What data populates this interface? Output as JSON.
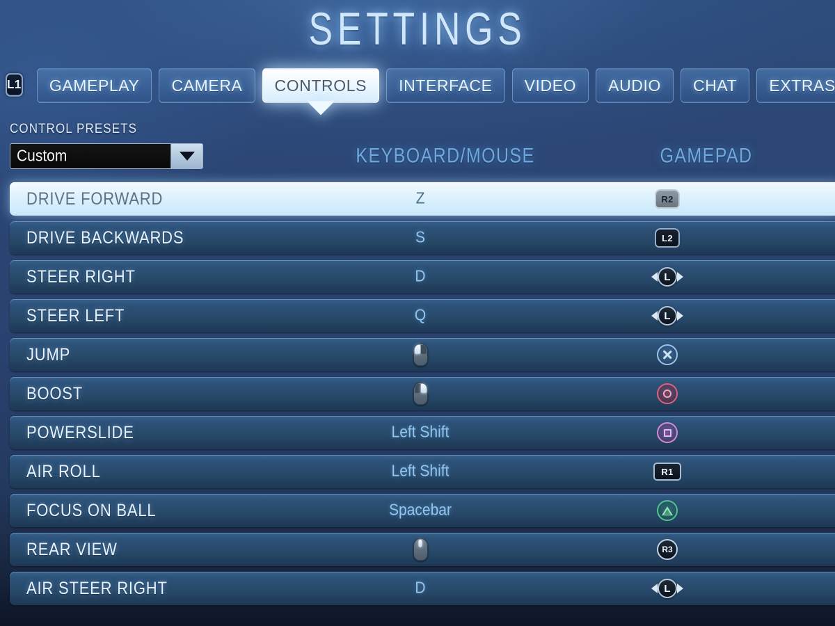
{
  "header": {
    "title": "SETTINGS",
    "shoulder_hint": "L1"
  },
  "tabs": [
    {
      "label": "GAMEPLAY",
      "active": false
    },
    {
      "label": "CAMERA",
      "active": false
    },
    {
      "label": "CONTROLS",
      "active": true
    },
    {
      "label": "INTERFACE",
      "active": false
    },
    {
      "label": "VIDEO",
      "active": false
    },
    {
      "label": "AUDIO",
      "active": false
    },
    {
      "label": "CHAT",
      "active": false
    },
    {
      "label": "EXTRAS",
      "active": false
    }
  ],
  "presets": {
    "label": "CONTROL PRESETS",
    "selected": "Custom",
    "dropdown_icon": "chevron-down-icon"
  },
  "columns": {
    "keyboard_mouse": "KEYBOARD/MOUSE",
    "gamepad": "GAMEPAD"
  },
  "bindings": [
    {
      "action": "DRIVE FORWARD",
      "kbm_text": "Z",
      "kbm_icon": null,
      "gamepad_icon": "r2-trigger-icon",
      "gamepad_label": "R2",
      "selected": true
    },
    {
      "action": "DRIVE BACKWARDS",
      "kbm_text": "S",
      "kbm_icon": null,
      "gamepad_icon": "l2-trigger-icon",
      "gamepad_label": "L2",
      "selected": false
    },
    {
      "action": "STEER RIGHT",
      "kbm_text": "D",
      "kbm_icon": null,
      "gamepad_icon": "left-stick-icon",
      "gamepad_label": "L",
      "selected": false
    },
    {
      "action": "STEER LEFT",
      "kbm_text": "Q",
      "kbm_icon": null,
      "gamepad_icon": "left-stick-icon",
      "gamepad_label": "L",
      "selected": false
    },
    {
      "action": "JUMP",
      "kbm_text": "",
      "kbm_icon": "mouse-left-icon",
      "gamepad_icon": "cross-button-icon",
      "gamepad_label": "",
      "selected": false
    },
    {
      "action": "BOOST",
      "kbm_text": "",
      "kbm_icon": "mouse-right-icon",
      "gamepad_icon": "circle-button-icon",
      "gamepad_label": "",
      "selected": false
    },
    {
      "action": "POWERSLIDE",
      "kbm_text": "Left Shift",
      "kbm_icon": null,
      "gamepad_icon": "square-button-icon",
      "gamepad_label": "",
      "selected": false
    },
    {
      "action": "AIR ROLL",
      "kbm_text": "Left Shift",
      "kbm_icon": null,
      "gamepad_icon": "r1-bumper-icon",
      "gamepad_label": "R1",
      "selected": false
    },
    {
      "action": "FOCUS ON BALL",
      "kbm_text": "Spacebar",
      "kbm_icon": null,
      "gamepad_icon": "triangle-button-icon",
      "gamepad_label": "",
      "selected": false
    },
    {
      "action": "REAR VIEW",
      "kbm_text": "",
      "kbm_icon": "mouse-middle-icon",
      "gamepad_icon": "r3-stick-click-icon",
      "gamepad_label": "R3",
      "selected": false
    },
    {
      "action": "AIR STEER RIGHT",
      "kbm_text": "D",
      "kbm_icon": null,
      "gamepad_icon": "left-stick-icon",
      "gamepad_label": "L",
      "selected": false
    }
  ],
  "colors": {
    "background": "#2a4371",
    "row": "#2d5279",
    "row_selected": "#ddf1fd",
    "accent_heading": "#6fa8dd",
    "circle_button": "#e0607e",
    "square_button": "#d48ad8",
    "triangle_button": "#4fc48d",
    "cross_button": "#9cc3e6"
  }
}
